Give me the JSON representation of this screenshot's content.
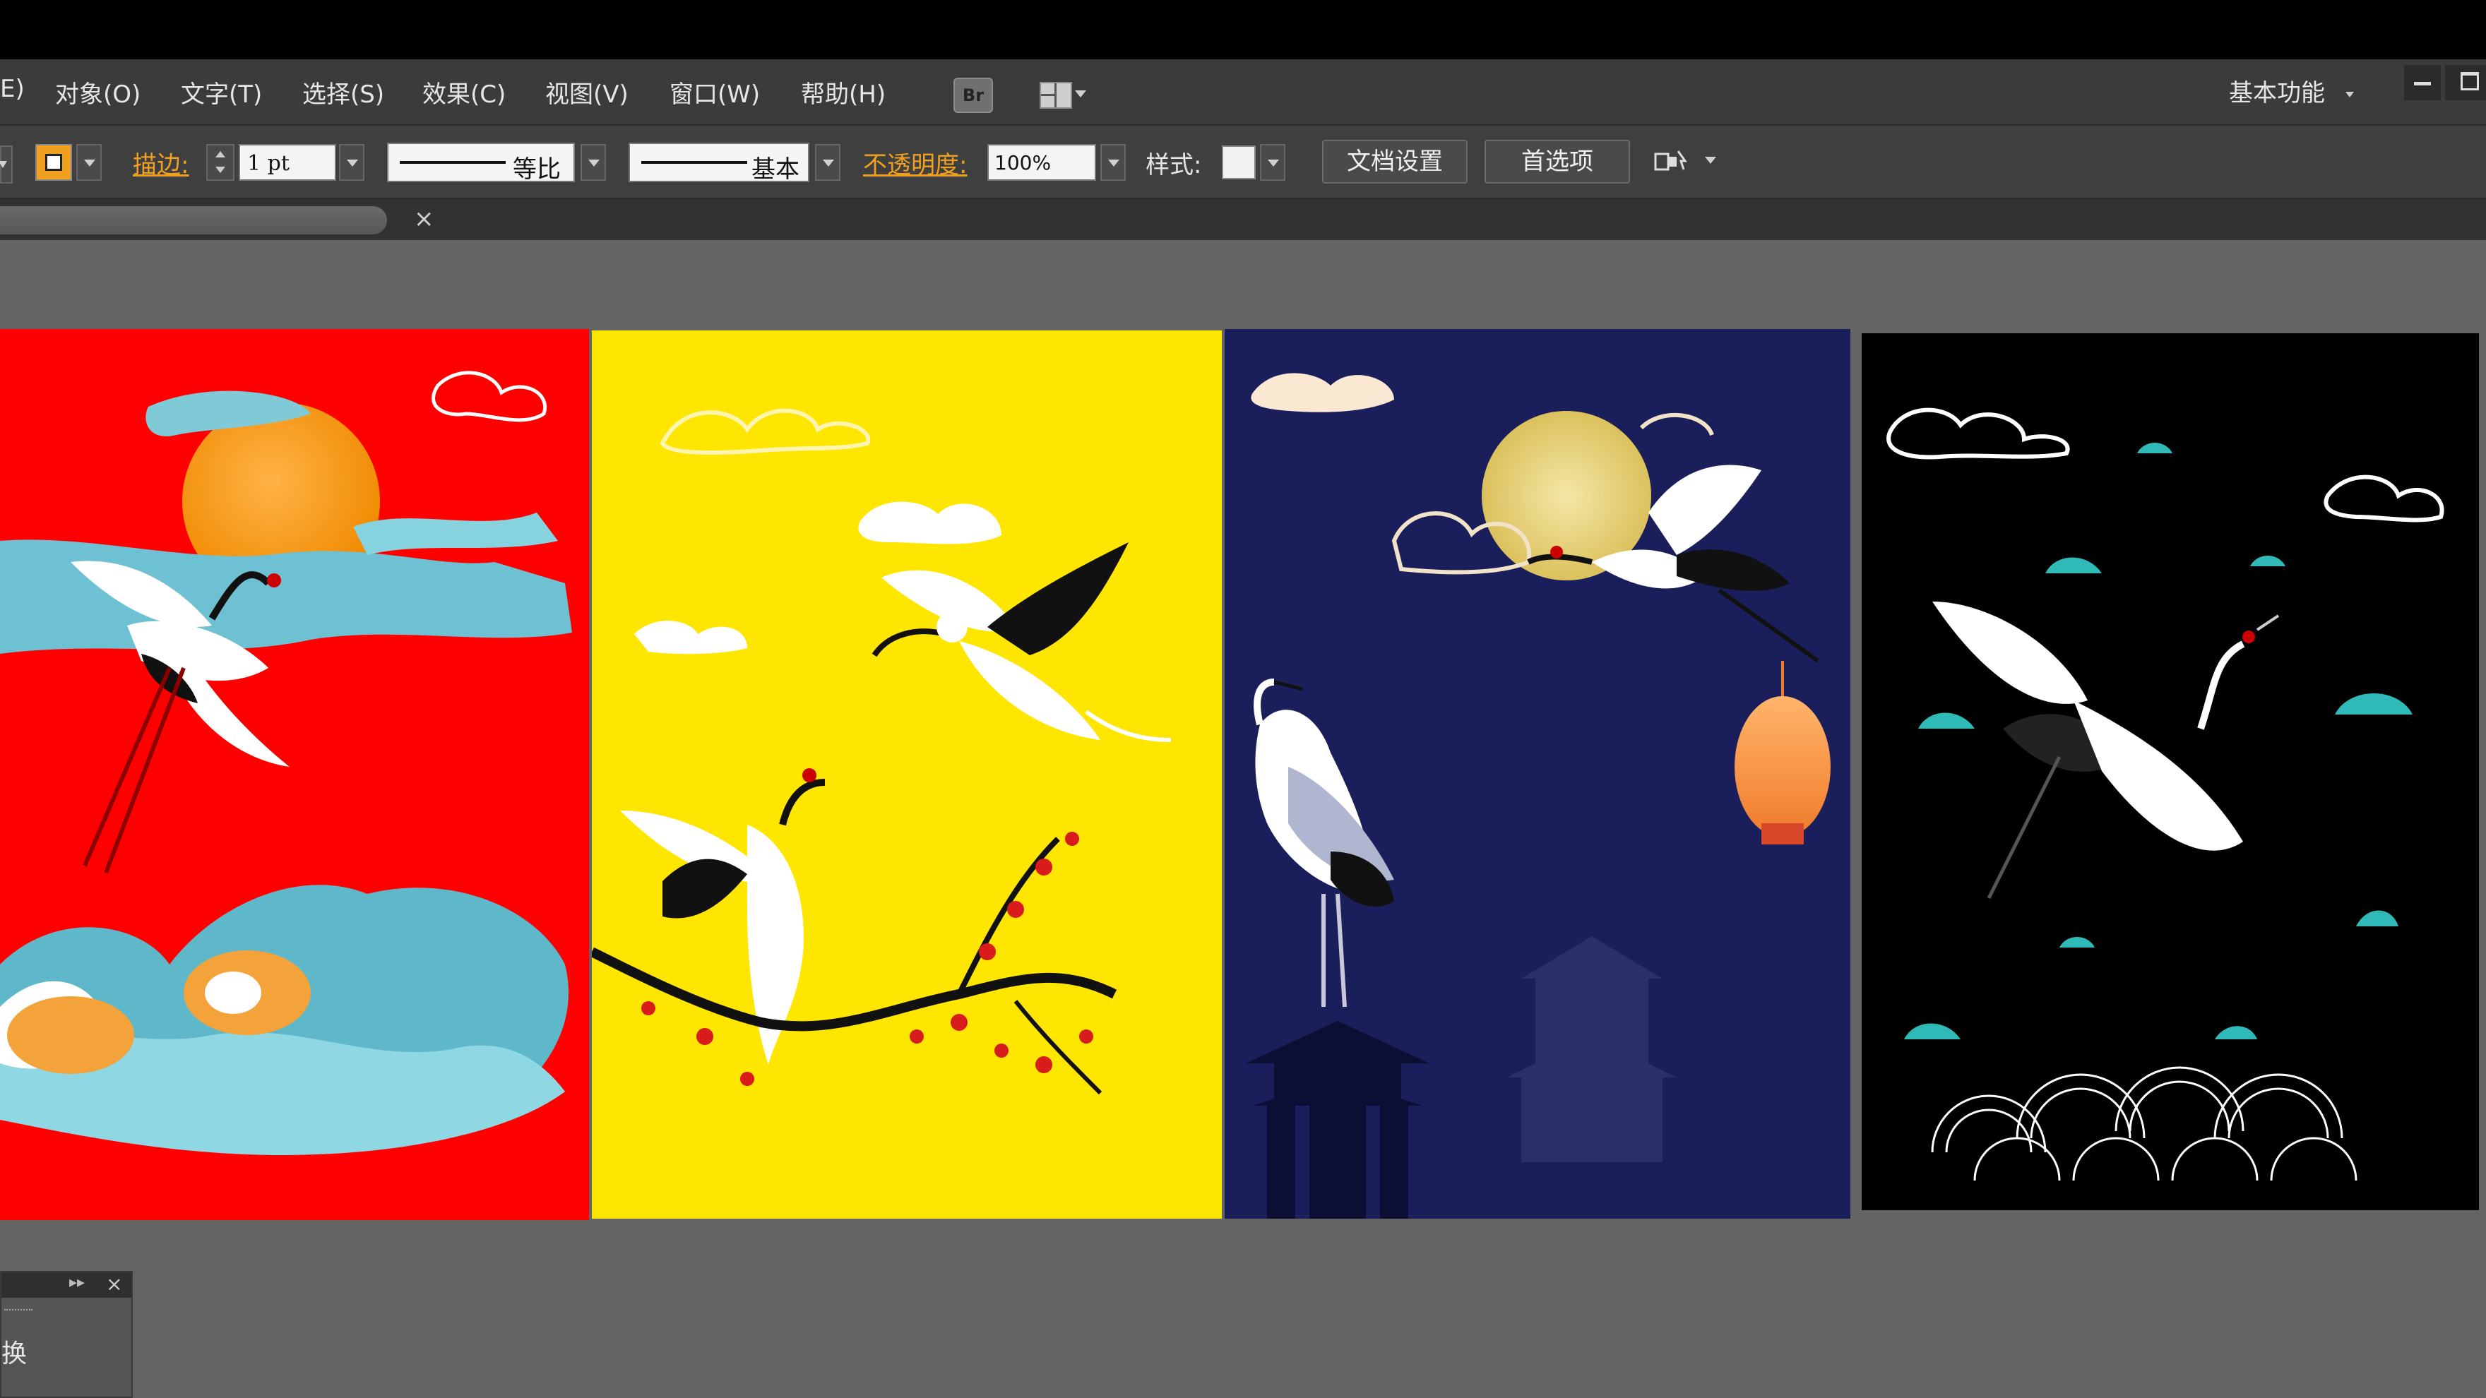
{
  "menubar": {
    "items": [
      "E)",
      "对象(O)",
      "文字(T)",
      "选择(S)",
      "效果(C)",
      "视图(V)",
      "窗口(W)",
      "帮助(H)"
    ],
    "bridge_label": "Br",
    "workspace_label": "基本功能"
  },
  "control_bar": {
    "stroke_label": "描边:",
    "stroke_weight": "1 pt",
    "profile_label": "等比",
    "brush_label": "基本",
    "opacity_label": "不透明度:",
    "opacity_value": "100%",
    "style_label": "样式:",
    "doc_setup_button": "文档设置",
    "preferences_button": "首选项"
  },
  "doc_tab": {
    "close_glyph": "×"
  },
  "panel": {
    "label": "换",
    "expand_glyph": "▸▸",
    "close_glyph": "×"
  },
  "artboards": [
    {
      "name": "red-crane-koi",
      "background": "#fe0000"
    },
    {
      "name": "yellow-crane-plum",
      "background": "#ffe600"
    },
    {
      "name": "navy-crane-moon",
      "background": "#1a1f5c"
    },
    {
      "name": "black-crane-clouds",
      "background": "#000000"
    }
  ],
  "colors": {
    "accent_orange": "#f0a020",
    "menubar": "#3b3b3b",
    "canvas": "#646464"
  }
}
